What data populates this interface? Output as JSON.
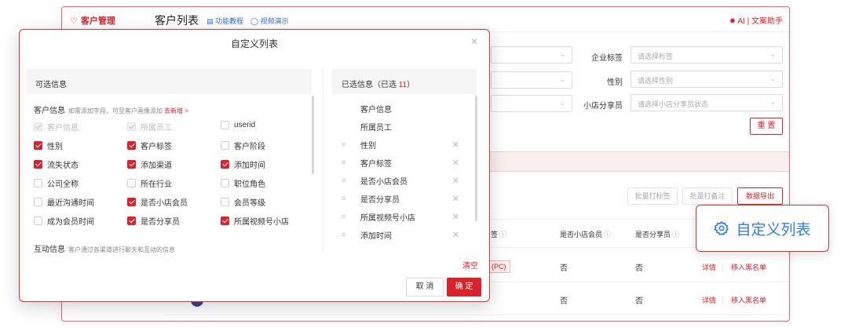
{
  "app": {
    "brand": "客户管理",
    "page_title": "客户列表",
    "tutorial_link": "功能教程",
    "video_link": "视频演示",
    "ai_button": "AI | 文案助手"
  },
  "filters": {
    "enterprise_tag_label": "企业标签",
    "enterprise_tag_placeholder": "请选择标签",
    "gender_label": "性别",
    "gender_placeholder": "请选择性别",
    "sharer_label": "小店分享员",
    "sharer_placeholder": "请选择小店分享员状态",
    "reset": "重 置"
  },
  "actions": {
    "bulk_tag": "批量打标签",
    "bulk_note": "批量打备注",
    "export": "数据导出"
  },
  "table": {
    "headers": [
      "签",
      "是否小店会员",
      "是否分享员"
    ],
    "rows": [
      {
        "tag": "(PC)",
        "member": "否",
        "sharer": "否",
        "detail": "详情",
        "blacklist": "移入黑名单"
      },
      {
        "member": "否",
        "sharer": "否",
        "detail": "详情",
        "blacklist": "移入黑名单"
      }
    ]
  },
  "callout": {
    "label": "自定义列表"
  },
  "modal": {
    "title": "自定义列表",
    "left_title": "可选信息",
    "right_title_prefix": "已选信息（已选 ",
    "right_count": "11",
    "right_title_suffix": "）",
    "customer_section": {
      "title": "客户信息",
      "desc": "如需添加字段，可至客户画像添加",
      "link": "去新增 >"
    },
    "interaction_section": {
      "title": "互动信息",
      "desc": "客户通过各渠道进行聊天和互动的信息"
    },
    "options": [
      {
        "label": "客户信息",
        "state": "disabled"
      },
      {
        "label": "所属员工",
        "state": "disabled"
      },
      {
        "label": "userid",
        "state": "off"
      },
      {
        "label": "性别",
        "state": "on"
      },
      {
        "label": "客户标签",
        "state": "on"
      },
      {
        "label": "客户阶段",
        "state": "off"
      },
      {
        "label": "流失状态",
        "state": "on"
      },
      {
        "label": "添加渠道",
        "state": "on"
      },
      {
        "label": "添加时间",
        "state": "on"
      },
      {
        "label": "公司全称",
        "state": "off"
      },
      {
        "label": "所在行业",
        "state": "off"
      },
      {
        "label": "职位角色",
        "state": "off"
      },
      {
        "label": "最近沟通时间",
        "state": "off"
      },
      {
        "label": "是否小店会员",
        "state": "on"
      },
      {
        "label": "会员等级",
        "state": "off"
      },
      {
        "label": "成为会员时间",
        "state": "off"
      },
      {
        "label": "是否分享员",
        "state": "on"
      },
      {
        "label": "所属视频号小店",
        "state": "on"
      }
    ],
    "fixed_selected": [
      "客户信息",
      "所属员工"
    ],
    "selected": [
      "性别",
      "客户标签",
      "是否小店会员",
      "是否分享员",
      "所属视频号小店",
      "添加时间"
    ],
    "clear": "清空",
    "cancel": "取 消",
    "confirm": "确 定"
  },
  "colors": {
    "accent": "#d9222a",
    "link": "#2f6fe0"
  }
}
